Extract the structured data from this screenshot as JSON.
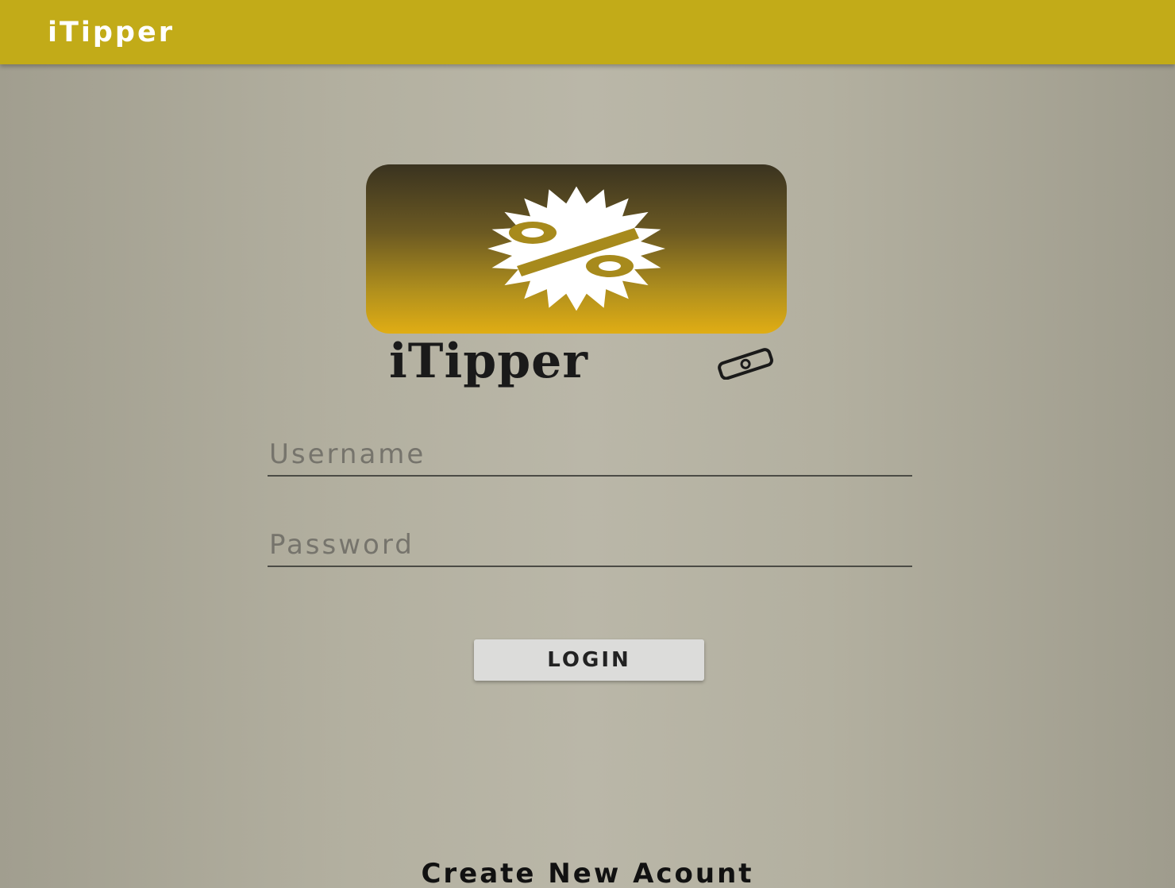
{
  "app_bar": {
    "title": "iTipper"
  },
  "logo": {
    "wordmark": "iTipper",
    "badge_symbol": "%",
    "icon": "percent-badge-icon",
    "cash_icon": "cash-bill-icon"
  },
  "form": {
    "username_placeholder": "Username",
    "password_placeholder": "Password",
    "login_label": "LOGIN"
  },
  "footer": {
    "create_account_label": "Create New Acount"
  },
  "colors": {
    "app_bar": "#c2ab18",
    "background": "#b3b0a0",
    "logo_gold": "#e0ad14",
    "logo_dark": "#3a3320",
    "button_bg": "#dcdcda"
  }
}
